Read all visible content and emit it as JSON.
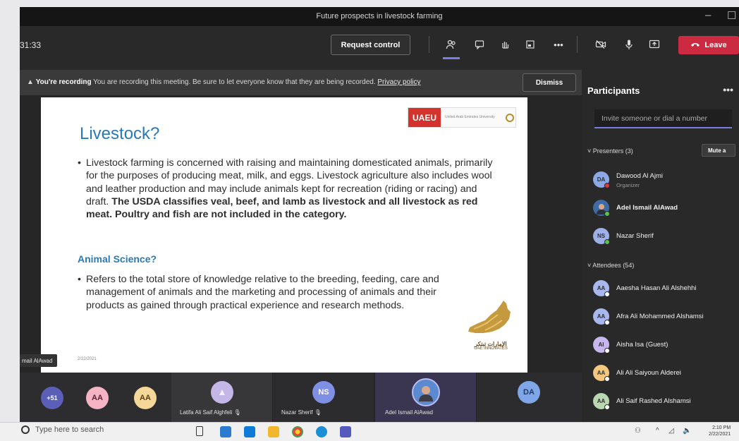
{
  "window": {
    "title": "Future prospects in livestock farming",
    "minimize_glyph": "–",
    "maximize_glyph": "☐"
  },
  "toolbar": {
    "timer": "31:33",
    "request_control": "Request control",
    "leave": "Leave",
    "icons": [
      "participants-icon",
      "chat-icon",
      "raise-hand-icon",
      "rooms-icon",
      "more-icon",
      "camera-off-icon",
      "mic-icon",
      "share-icon",
      "phone-icon"
    ],
    "more_glyph": "•••"
  },
  "banner": {
    "title": "You're recording",
    "message": "You are recording this meeting. Be sure to let everyone know that they are being recorded.",
    "link": "Privacy policy",
    "dismiss": "Dismiss"
  },
  "slide": {
    "logo_text": "UAEU",
    "logo_sub": "United Arab Emirates University",
    "title": "Livestock?",
    "bullet": "•",
    "bullet1_plain": "Livestock farming is concerned with raising and maintaining domesticated animals, primarily for the purposes of producing meat, milk, and eggs. Livestock agriculture also includes wool and leather production and may include animals kept for recreation (riding or racing) and draft.",
    "bullet1_bold": "The USDA classifies veal, beef, and lamb as livestock and all livestock as red meat. Poultry and fish are not included in the category.",
    "subheading": "Animal Science?",
    "bullet2": "Refers to the total store of knowledge relative to the breeding, feeding, care and management of animals and the marketing and processing of animals and their products as gained through practical experience and research methods.",
    "date": "2/22/2021",
    "innovates_ar": "الإمارات تبتكر",
    "innovates_en": "UAE INNOVATES"
  },
  "presenter_tag": "mail AlAwad",
  "strip": {
    "overflow": "+51",
    "avatars": [
      {
        "initials": "AA",
        "bg": "#f4b4c4",
        "fg": "#5a1f33"
      },
      {
        "initials": "AA",
        "bg": "#f6d79a",
        "fg": "#5a3f0a"
      }
    ],
    "tiles": [
      {
        "name": "Latifa Ali Saif Alghfeli",
        "initials": "",
        "bg": "#c4b6e6"
      },
      {
        "name": "Nazar Sherif",
        "initials": "NS",
        "bg": "#7f8fe4"
      },
      {
        "name": "Adel Ismail AlAwad",
        "initials": "",
        "bg": "#5b8ad0"
      },
      {
        "name": "",
        "initials": "DA",
        "bg": "#7fa6e6"
      }
    ]
  },
  "panel": {
    "heading": "Participants",
    "more_glyph": "•••",
    "invite_placeholder": "Invite someone or dial a number",
    "presenters_label": "Presenters (3)",
    "mute_all": "Mute a",
    "presenters": [
      {
        "initials": "DA",
        "name": "Dawood Al Ajmi",
        "role": "Organizer",
        "bg": "#8ca9e6",
        "status": "#d83b3b"
      },
      {
        "initials": "",
        "name": "Adel Ismail AlAwad",
        "role": "",
        "bg": "#3e6aa6",
        "status": "#5fbf4f"
      },
      {
        "initials": "NS",
        "name": "Nazar Sherif",
        "role": "",
        "bg": "#9fb0e8",
        "status": "#5fbf4f"
      }
    ],
    "attendees_label": "Attendees (54)",
    "attendees": [
      {
        "initials": "AA",
        "name": "Aaesha Hasan Ali Alshehhi",
        "bg": "#a8b8ef",
        "status": "#ffffff"
      },
      {
        "initials": "AA",
        "name": "Afra Ali Mohammed Alshamsi",
        "bg": "#a8b8ef",
        "status": "#ffffff"
      },
      {
        "initials": "AI",
        "name": "Aisha Isa (Guest)",
        "bg": "#c6b8ef",
        "status": "#ffffff"
      },
      {
        "initials": "AA",
        "name": "Ali Ali Saiyoun Alderei",
        "bg": "#f3c77e",
        "status": "#ffffff"
      },
      {
        "initials": "AA",
        "name": "Ali Saif Rashed Alshamsi",
        "bg": "#b9d7b0",
        "status": "#ffffff"
      }
    ]
  },
  "taskbar": {
    "search_placeholder": "Type here to search",
    "clock_time": "2:10 PM",
    "clock_date": "2/22/2021"
  }
}
